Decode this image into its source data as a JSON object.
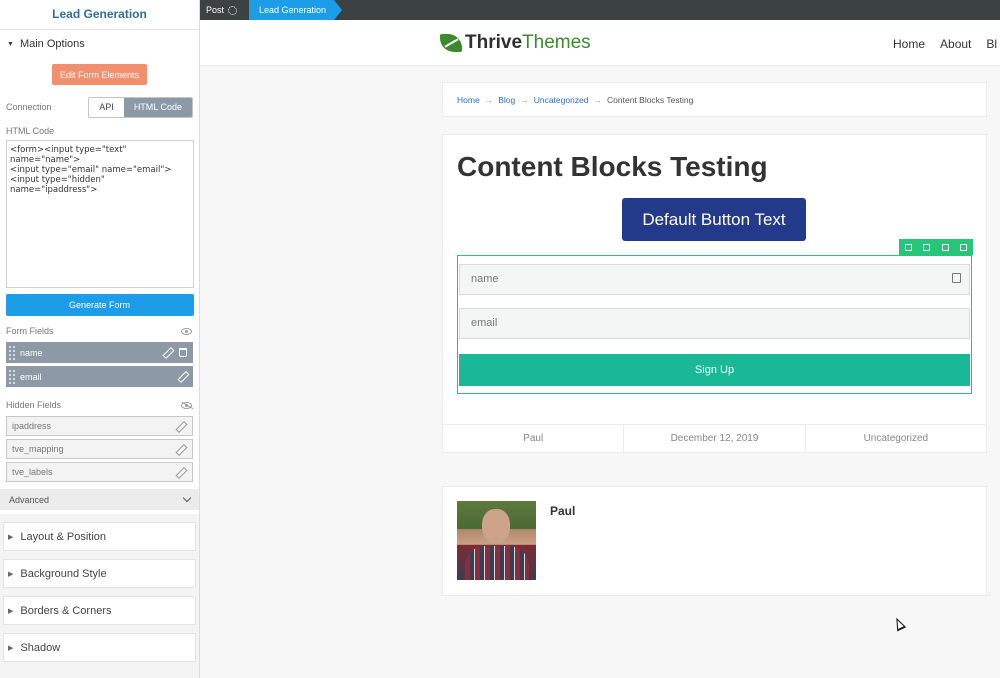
{
  "sidebar": {
    "title": "Lead Generation",
    "main_options": "Main Options",
    "edit_form_elements": "Edit Form Elements",
    "connection_label": "Connection",
    "connection_options": [
      "API",
      "HTML Code"
    ],
    "connection_selected": "HTML Code",
    "html_code_label": "HTML Code",
    "html_code_value": "<form><input type=\"text\"\nname=\"name\">\n<input type=\"email\" name=\"email\">\n<input type=\"hidden\"\nname=\"ipaddress\">",
    "generate_form": "Generate Form",
    "form_fields_label": "Form Fields",
    "form_fields": [
      {
        "name": "name"
      },
      {
        "name": "email"
      }
    ],
    "hidden_fields_label": "Hidden Fields",
    "hidden_fields": [
      {
        "name": "ipaddress"
      },
      {
        "name": "tve_mapping"
      },
      {
        "name": "tve_labels"
      }
    ],
    "advanced": "Advanced",
    "sections": [
      "Layout & Position",
      "Background Style",
      "Borders & Corners",
      "Shadow"
    ]
  },
  "topbar": {
    "post": "Post",
    "current": "Lead Generation"
  },
  "site": {
    "logo_bold": "Thrive",
    "logo_light": "Themes",
    "nav": [
      "Home",
      "About",
      "Bl"
    ],
    "breadcrumb": {
      "links": [
        "Home",
        "Blog",
        "Uncategorized"
      ],
      "separator": "→",
      "current": "Content Blocks Testing"
    },
    "post_title": "Content Blocks Testing",
    "default_button": "Default Button Text",
    "form": {
      "name_placeholder": "name",
      "email_placeholder": "email",
      "submit": "Sign Up"
    },
    "meta": {
      "author": "Paul",
      "date": "December 12, 2019",
      "category": "Uncategorized"
    },
    "author_box_name": "Paul"
  },
  "colors": {
    "accent_blue": "#1d9ce7",
    "edit_button": "#f28f6f",
    "primary_button": "#233a8a",
    "signup_green": "#19b997",
    "selection_green": "#27c479"
  }
}
